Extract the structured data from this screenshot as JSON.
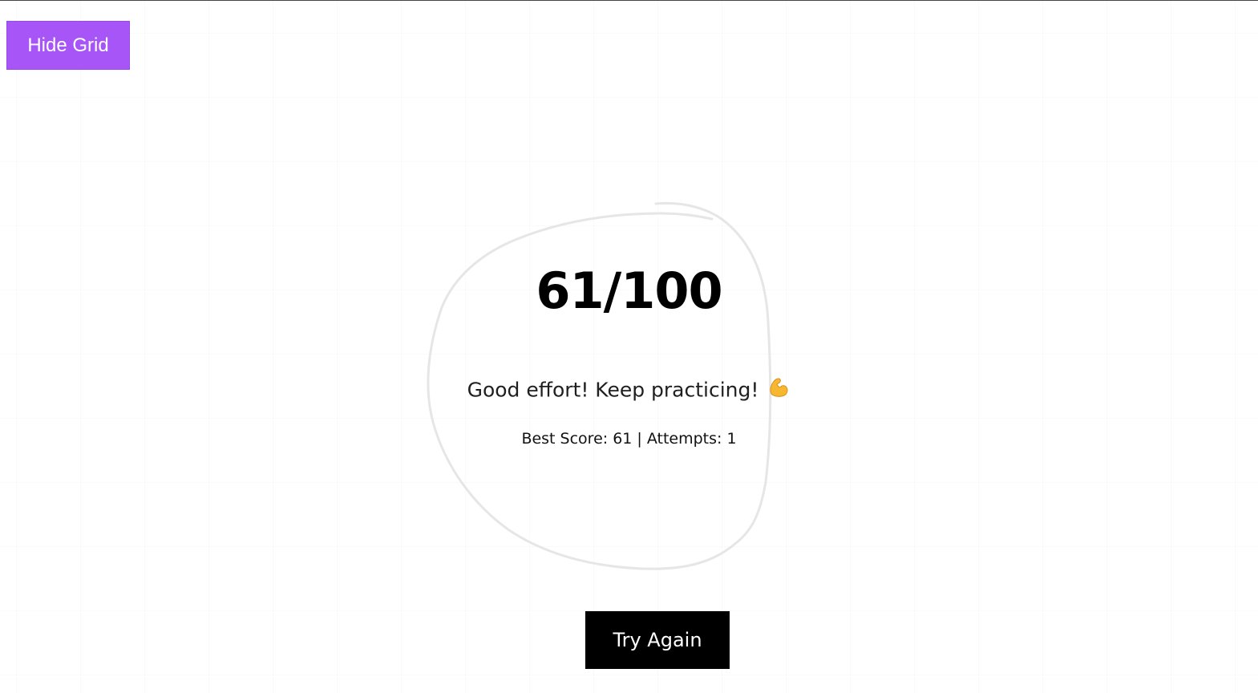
{
  "controls": {
    "grid_toggle_label": "Hide Grid",
    "try_again_label": "Try Again"
  },
  "result": {
    "score_text": "61/100",
    "score": 61,
    "max_score": 100,
    "message": "Good effort! Keep practicing!",
    "emoji": "flexed-biceps-icon",
    "stats_text": "Best Score: 61 | Attempts: 1",
    "best_score": 61,
    "attempts": 1
  },
  "colors": {
    "grid_toggle_bg": "#a855f7",
    "try_again_bg": "#000000",
    "drawn_stroke": "#e6e6e6",
    "emoji_fill": "#f7b731"
  }
}
